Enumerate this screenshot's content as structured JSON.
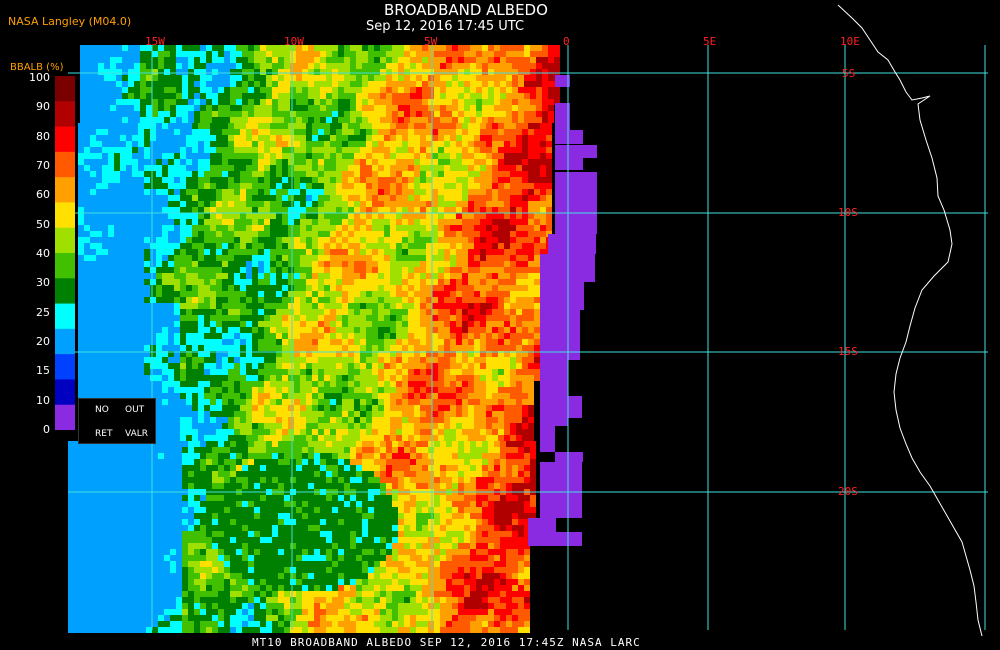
{
  "header": {
    "title": "BROADBAND ALBEDO",
    "subtitle": "Sep 12, 2016 17:45 UTC",
    "source": "NASA Langley (M04.0)"
  },
  "footer": {
    "text": "MT10   BROADBAND ALBEDO    SEP 12, 2016 17:45Z    NASA LARC"
  },
  "colorbar": {
    "label": "BBALB (%)",
    "ticks": [
      "100",
      "90",
      "80",
      "70",
      "60",
      "50",
      "40",
      "30",
      "25",
      "20",
      "15",
      "10",
      "0"
    ],
    "colors": [
      "#7a0000",
      "#b00000",
      "#ff0000",
      "#ff5a00",
      "#ffa000",
      "#ffe000",
      "#a0e000",
      "#40c000",
      "#008000",
      "#00ffff",
      "#00a0ff",
      "#0040ff",
      "#0000c0",
      "#8a2be2"
    ]
  },
  "legend_extra": {
    "no": "NO",
    "out": "OUT",
    "ret": "RET",
    "valr": "VALR"
  },
  "grid": {
    "lon_labels": [
      "15W",
      "10W",
      "5W",
      "0",
      "5E",
      "10E"
    ],
    "lat_labels": [
      "5S",
      "10S",
      "15S",
      "20S"
    ],
    "grid_color": "#40e0e0",
    "label_color": "#ff2020"
  }
}
